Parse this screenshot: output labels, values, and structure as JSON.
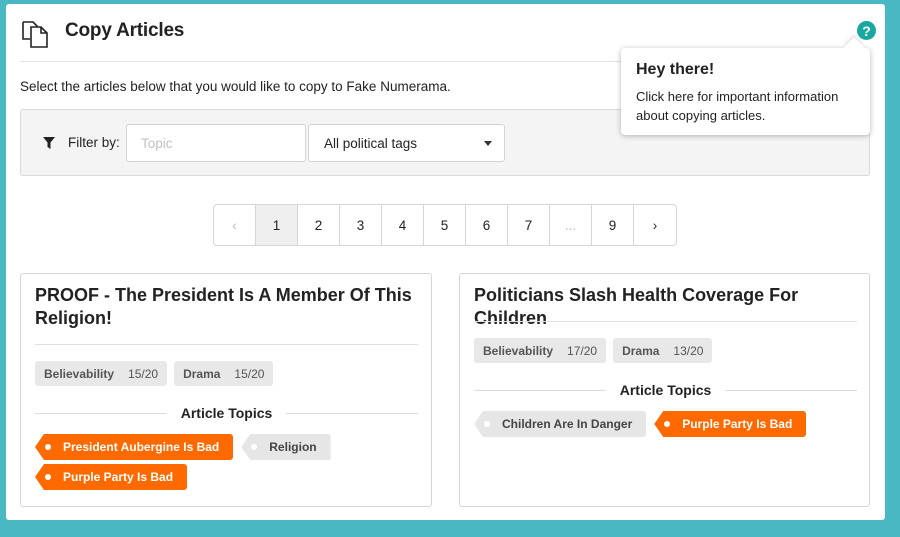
{
  "header": {
    "title": "Copy Articles",
    "help_icon": "question-circle-icon",
    "help_label": "?"
  },
  "intro_text": "Select the articles below that you would like to copy to Fake Numerama.",
  "filter": {
    "label": "Filter by:",
    "topic_placeholder": "Topic",
    "tags_selected": "All political tags"
  },
  "pagination": {
    "prev": "‹",
    "pages": [
      "1",
      "2",
      "3",
      "4",
      "5",
      "6",
      "7",
      "...",
      "9"
    ],
    "next": "›",
    "current": "1"
  },
  "tooltip": {
    "title": "Hey there!",
    "body": "Click here for important information about copying articles."
  },
  "articles": [
    {
      "title": "PROOF - The President Is A Member Of This Religion!",
      "scores": [
        {
          "label": "Believability",
          "value": "15/20"
        },
        {
          "label": "Drama",
          "value": "15/20"
        }
      ],
      "topics_heading": "Article Topics",
      "topics": [
        {
          "label": "President Aubergine Is Bad",
          "selected": true
        },
        {
          "label": "Religion",
          "selected": false
        },
        {
          "label": "Purple Party Is Bad",
          "selected": true
        }
      ]
    },
    {
      "title": "Politicians Slash Health Coverage For Children",
      "scores": [
        {
          "label": "Believability",
          "value": "17/20"
        },
        {
          "label": "Drama",
          "value": "13/20"
        }
      ],
      "topics_heading": "Article Topics",
      "topics": [
        {
          "label": "Children Are In Danger",
          "selected": false
        },
        {
          "label": "Purple Party Is Bad",
          "selected": true
        }
      ]
    }
  ],
  "colors": {
    "background": "#49b8c2",
    "accent": "#ff6a00",
    "help": "#1aa7a0"
  }
}
